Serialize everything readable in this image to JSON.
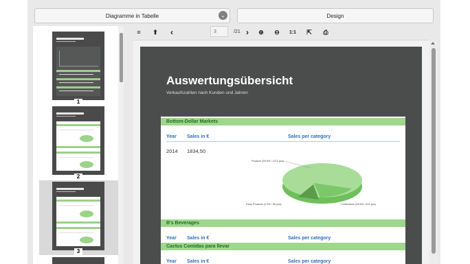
{
  "header": {
    "left_dropdown": "Diagramme in Tabelle",
    "right_button": "Design"
  },
  "toolbar": {
    "menu_icon": "≡",
    "first_icon": "⬆",
    "prev_icon": "‹",
    "page_value": "3",
    "page_total": "/21",
    "next_icon": "›",
    "zoom_in_icon": "⊕",
    "zoom_out_icon": "⊖",
    "actual_size": "1:1",
    "export_icon": "⇱",
    "print_icon": "⎙"
  },
  "thumbnails": [
    {
      "number": "1"
    },
    {
      "number": "2"
    },
    {
      "number": "3"
    }
  ],
  "report": {
    "title": "Auswertungsübersicht",
    "subtitle": "Verkaufszahlen nach Kunden und Jahren",
    "sections": [
      {
        "name": "Bottom-Dollar Markets"
      },
      {
        "name": "B's Beverages"
      },
      {
        "name": "Cactus Comidas para llevar"
      }
    ],
    "headers": {
      "year": "Year",
      "sales": "Sales in €",
      "category": "Sales per category"
    },
    "row": {
      "year": "2014",
      "sales": "1834,50"
    },
    "pie_labels": {
      "produce": "Produce (59,5% / 1272 pcs)",
      "dairy": "Dairy Products (2,5% / 56 pcs)",
      "confections": "Confections (28,6% / 515 pcs)"
    }
  }
}
